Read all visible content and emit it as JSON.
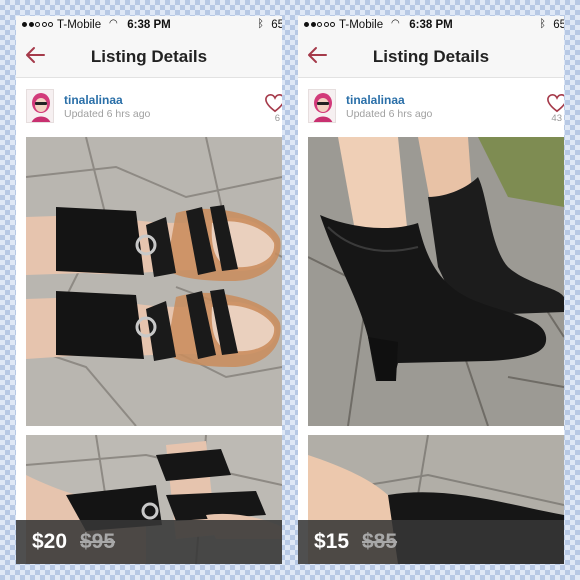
{
  "status_bar": {
    "carrier": "T-Mobile",
    "time": "6:38 PM",
    "battery": "65"
  },
  "nav": {
    "title": "Listing Details"
  },
  "colors": {
    "accent": "#a53a4a",
    "username": "#2a6fa8",
    "price_bar": "#373737"
  },
  "listings": [
    {
      "seller": {
        "username": "tinalalinaa",
        "updated": "Updated 6 hrs ago"
      },
      "likes": "6",
      "price": "$20",
      "original_price": "$95",
      "photos": [
        "black patent gladiator sandals",
        "black gladiator sandals close-up"
      ]
    },
    {
      "seller": {
        "username": "tinalalinaa",
        "updated": "Updated 6 hrs ago"
      },
      "likes": "43",
      "price": "$15",
      "original_price": "$85",
      "photos": [
        "black slouch heeled ankle boots",
        "black ankle boot close-up"
      ]
    }
  ],
  "icons": [
    "wifi-icon",
    "bluetooth-icon",
    "back-arrow-icon",
    "heart-icon",
    "avatar"
  ]
}
